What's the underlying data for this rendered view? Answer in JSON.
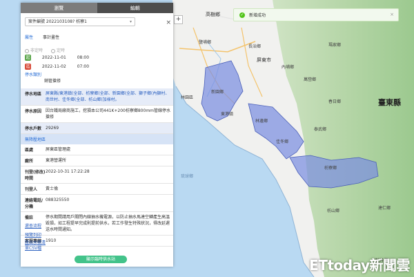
{
  "tabs": [
    {
      "label": "瀏覽"
    },
    {
      "label": "編輯"
    }
  ],
  "case_select": {
    "value": "案件編號 2022103108? 枋寮1"
  },
  "fields": {
    "attr_label": "屬性",
    "attr_value": "事計畫性",
    "radio_a": "非定時",
    "radio_b": "定時",
    "start_badge": "起",
    "start_date": "2022-11-01",
    "start_time": "08:00",
    "end_badge": "迄",
    "end_date": "2022-11-02",
    "end_time": "07:00",
    "type_label": "停水類別",
    "type_value": "銷管搶修"
  },
  "info": {
    "area_k": "停水地區",
    "area_v": "屏東縣/東港鎮(全部、枋寮鄉(全部、新園鄉(全部、獅子鄉(內獅村、南世村、佳冬鄉(全部、枋山鄉(加祿村。",
    "reason_k": "停水原因",
    "reason_v": "因台鐵局廠商施工，挖損本公司441K+200枋寮鄉800mm管線停水搶修",
    "households_k": "停水戶數",
    "households_v": "29269",
    "section": "無降壓地區",
    "region_k": "區處",
    "region_v": "屏東區管理處",
    "office_k": "廠所",
    "office_v": "東港營運所",
    "time_k": "刊登(修改)時間",
    "time_v": "2022-10-31 17:22:28",
    "poster_k": "刊登人",
    "poster_v": "黃士倫",
    "phone_k": "連絡電話/分機",
    "phone_v": "088325550",
    "note_k": "備註",
    "note_v": "停水期間請用戶關閉內線抽水機電源，以防止抽水馬達空轉產生高溫毀損，如工程提早完成則提前供水，若工作發生特殊狀況，得改延遲送水時間通知。",
    "service_k": "客服專線",
    "service_v": "1910"
  },
  "links": [
    "還查流程",
    "預覽列印",
    "匯出水號清單CSV檔"
  ],
  "bottom_button": "顯示臨時供水站",
  "toast": {
    "text": "新增成功"
  },
  "map_labels": {
    "taitung": "臺東縣",
    "gaoshu": "高樹鄉",
    "yanpu": "鹽埔鄉",
    "changzhi": "長治鄉",
    "pingtung": "屏東市",
    "neipu": "內埔鄉",
    "wanluan": "萬巒鄉",
    "majia": "瑪家鄉",
    "chunri": "春日鄉",
    "taiwu": "泰武鄉",
    "xinyuan": "新園鄉",
    "donggang": "東港鎮",
    "linbian": "林邊鄉",
    "jiadong": "佳冬鄉",
    "linyuan": "林園區",
    "fangliao": "枋寮鄉",
    "fangshan": "枋山鄉",
    "mudan": "牡丹鄉",
    "daren": "達仁鄉",
    "xiaoliuqiu": "琉球鄉"
  },
  "watermark": "ETtoday新聞雲",
  "colors": {
    "highlight": "#7b8fe0",
    "button": "#43c38a",
    "tab_active": "#7c7c7c"
  }
}
